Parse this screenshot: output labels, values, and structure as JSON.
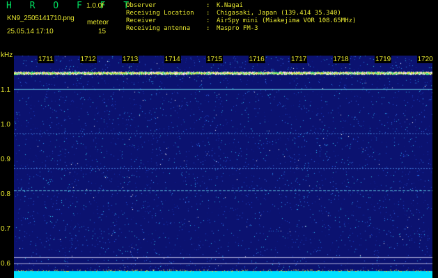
{
  "header": {
    "app_title": "H R O F F T",
    "version": "1.0.0f",
    "filename": "KN9_2505141710.png",
    "timestamp": "25.05.14 17:10",
    "meteor_label": "meteor",
    "meteor_count": "15"
  },
  "info": {
    "observer_label": "Observer",
    "observer_value": "K.Nagai",
    "location_label": "Receiving Location",
    "location_value": "Chigasaki, Japan (139.414 35.340)",
    "receiver_label": "Receiver",
    "receiver_value": "AirSpy mini (Miakejima VOR 108.65MHz)",
    "antenna_label": "Receiving antenna",
    "antenna_value": "Maspro FM-3",
    "separator": ":"
  },
  "axes": {
    "y_unit": "kHz",
    "y_ticks": [
      "1.1",
      "1.0",
      "0.9",
      "0.8",
      "0.7",
      "0.6"
    ],
    "x_ticks": [
      "1711",
      "1712",
      "1713",
      "1714",
      "1715",
      "1716",
      "1717",
      "1718",
      "1719",
      "1720"
    ]
  },
  "colors": {
    "text": "#e8e830",
    "title": "#00e060",
    "background": "#0b1270",
    "signal": "#ffd8ff",
    "noise_floor": "#00e0ff"
  }
}
